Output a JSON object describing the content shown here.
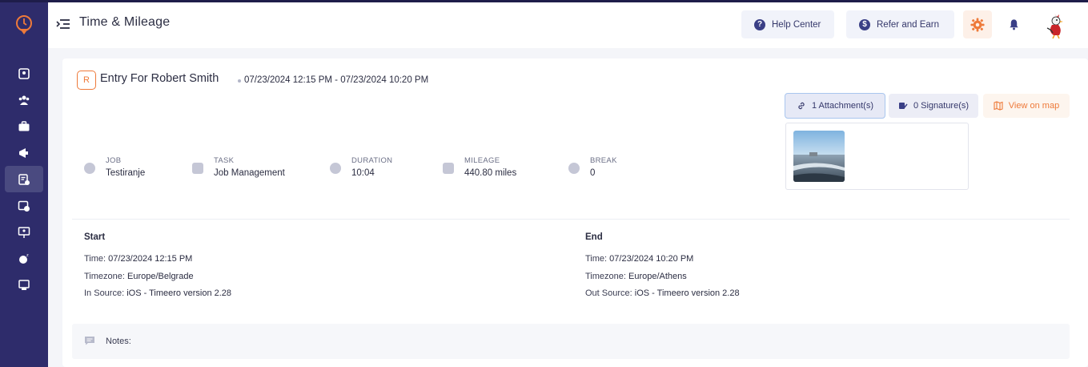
{
  "header": {
    "title": "Time & Mileage",
    "help_label": "Help Center",
    "refer_label": "Refer and Earn"
  },
  "entry": {
    "badge": "R",
    "title": "Entry For Robert Smith",
    "range": "07/23/2024 12:15 PM - 07/23/2024 10:20 PM",
    "attachments_label": "1 Attachment(s)",
    "signatures_label": "0 Signature(s)",
    "map_label": "View on map"
  },
  "stats": [
    {
      "label": "JOB",
      "value": "Testiranje",
      "icon": "briefcase-icon"
    },
    {
      "label": "TASK",
      "value": "Job Management",
      "icon": "task-icon"
    },
    {
      "label": "DURATION",
      "value": "10:04",
      "icon": "clock-icon"
    },
    {
      "label": "MILEAGE",
      "value": "440.80 miles",
      "icon": "mileage-icon"
    },
    {
      "label": "BREAK",
      "value": "0",
      "icon": "break-icon"
    }
  ],
  "start": {
    "title": "Start",
    "time_label": "Time:",
    "time": "07/23/2024 12:15 PM",
    "tz_label": "Timezone:",
    "tz": "Europe/Belgrade",
    "source_label": "In Source:",
    "source": "iOS - Timeero version 2.28"
  },
  "end": {
    "title": "End",
    "time_label": "Time:",
    "time": "07/23/2024 10:20 PM",
    "tz_label": "Timezone:",
    "tz": "Europe/Athens",
    "source_label": "Out Source:",
    "source": "iOS - Timeero version 2.28"
  },
  "notes": {
    "label": "Notes:"
  },
  "colors": {
    "sidebar": "#2e2c6b",
    "accent": "#ee7a3a",
    "primary": "#35386b"
  }
}
